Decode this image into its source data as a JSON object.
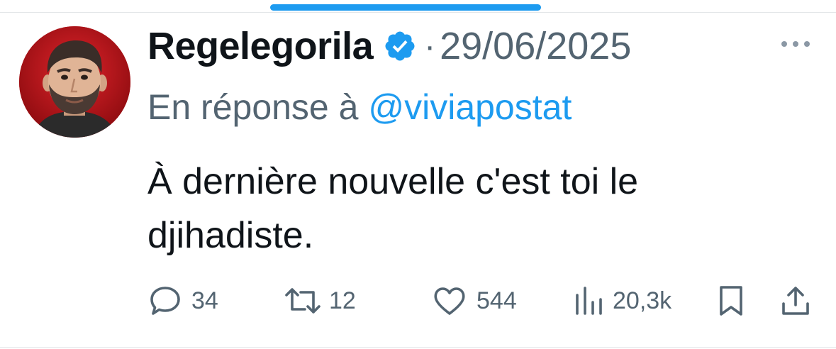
{
  "tweet": {
    "display_name": "Regelegorila",
    "verified_icon": "verified-badge-icon",
    "separator": "·",
    "date": "29/06/2025",
    "more_icon": "more-dots-icon",
    "reply_prefix": "En réponse à",
    "reply_handle": "@viviapostat",
    "text_line1": "À dernière nouvelle c'est toi le",
    "text_line2": "djihadiste."
  },
  "actions": {
    "replies": "34",
    "retweets": "12",
    "likes": "544",
    "views": "20,3k"
  },
  "icons": {
    "reply": "speech-bubble-icon",
    "retweet": "retweet-arrows-icon",
    "like": "heart-icon",
    "views": "bar-chart-icon",
    "bookmark": "bookmark-icon",
    "share": "share-upload-icon"
  },
  "colors": {
    "accent": "#1d9bf0",
    "secondary_text": "#536471",
    "primary_text": "#0f1419",
    "avatar_background": "#c8141b"
  }
}
